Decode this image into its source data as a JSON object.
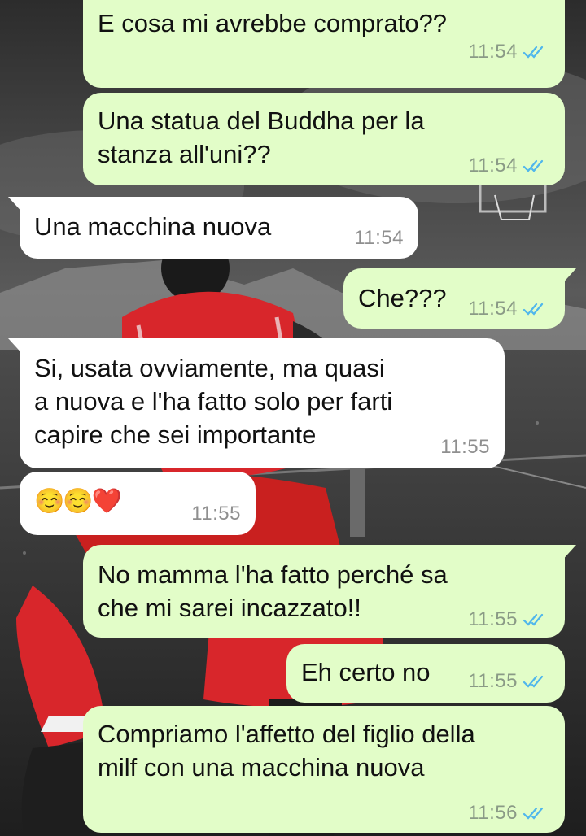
{
  "messages": [
    {
      "direction": "out",
      "text": "E cosa mi avrebbe comprato??",
      "time": "11:54",
      "status": "read"
    },
    {
      "direction": "out",
      "text": "Una statua del Buddha per la\nstanza all'uni??",
      "time": "11:54",
      "status": "read"
    },
    {
      "direction": "in",
      "text": "Una macchina nuova",
      "time": "11:54"
    },
    {
      "direction": "out",
      "text": "Che???",
      "time": "11:54",
      "status": "read"
    },
    {
      "direction": "in",
      "text": "Si, usata ovviamente, ma quasi\na nuova e l'ha fatto solo per farti\ncapire che sei importante",
      "time": "11:55"
    },
    {
      "direction": "in",
      "text": "☺️☺️❤️",
      "time": "11:55"
    },
    {
      "direction": "out",
      "text": "No mamma l'ha fatto perché sa\nche mi sarei incazzato!!",
      "time": "11:55",
      "status": "read"
    },
    {
      "direction": "out",
      "text": "Eh certo no",
      "time": "11:55",
      "status": "read"
    },
    {
      "direction": "out",
      "text": "Compriamo l'affetto del figlio della\nmilf con una macchina nuova",
      "time": "11:56",
      "status": "read"
    }
  ],
  "colors": {
    "outgoing_bubble": "#e2fdc8",
    "incoming_bubble": "#ffffff",
    "read_ticks": "#4fb6ec",
    "jersey_red": "#d8262b"
  },
  "icons": {
    "read_receipt": "double-check-icon"
  }
}
